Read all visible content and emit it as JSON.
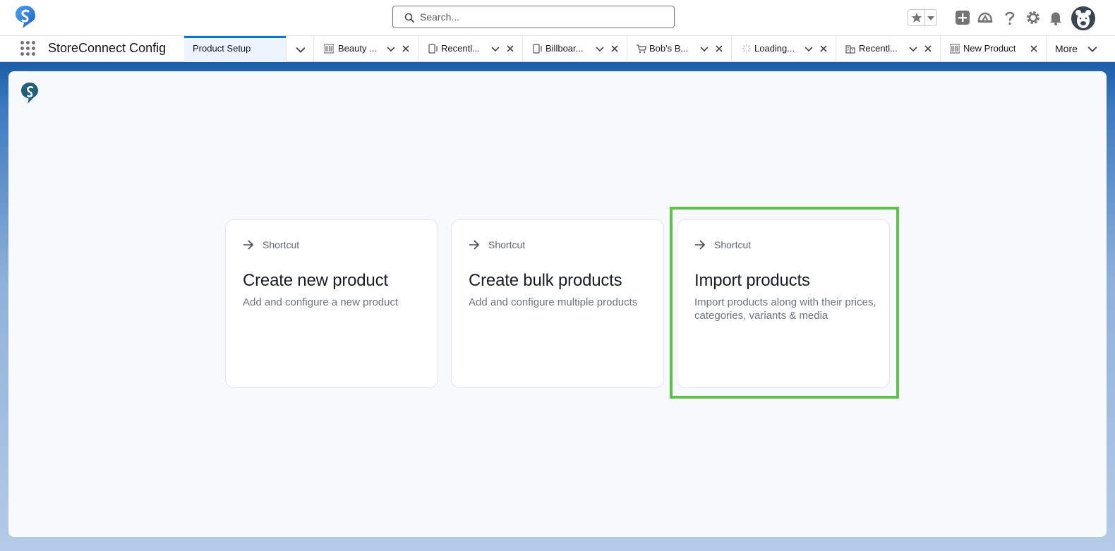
{
  "header": {
    "search": {
      "placeholder": "Search..."
    },
    "icons": [
      "favorites-star-icon",
      "global-actions-plus-icon",
      "trailhead-guidance-icon",
      "help-icon",
      "setup-gear-icon",
      "notifications-bell-icon",
      "user-avatar"
    ]
  },
  "nav": {
    "app_name": "StoreConnect Config",
    "tabs": [
      {
        "label": "Product Setup",
        "icon": "",
        "active": true,
        "closable": false
      },
      {
        "label": "Beauty ...",
        "icon": "barcode-icon",
        "active": false,
        "closable": true
      },
      {
        "label": "Recentl...",
        "icon": "device-icon",
        "active": false,
        "closable": true
      },
      {
        "label": "Billboar...",
        "icon": "device-icon",
        "active": false,
        "closable": true
      },
      {
        "label": "Bob's B...",
        "icon": "cart-icon",
        "active": false,
        "closable": true
      },
      {
        "label": "Loading...",
        "icon": "spinner-icon",
        "active": false,
        "closable": true
      },
      {
        "label": "Recentl...",
        "icon": "building-icon",
        "active": false,
        "closable": true
      },
      {
        "label": "New Product",
        "icon": "barcode-icon",
        "active": false,
        "closable": true
      }
    ],
    "more_label": "More"
  },
  "shortcuts": [
    {
      "label": "Shortcut",
      "title": "Create new product",
      "description": "Add and configure a new product",
      "highlighted": false
    },
    {
      "label": "Shortcut",
      "title": "Create bulk products",
      "description": "Add and configure multiple products",
      "highlighted": false
    },
    {
      "label": "Shortcut",
      "title": "Import products",
      "description": "Import products along with their prices, categories, variants & media",
      "highlighted": true
    }
  ],
  "colors": {
    "accent": "#0176d3",
    "highlight": "#5ec24a",
    "background_gradient_top": "#1b5fa8",
    "background_gradient_bottom": "#b3cbe7"
  }
}
